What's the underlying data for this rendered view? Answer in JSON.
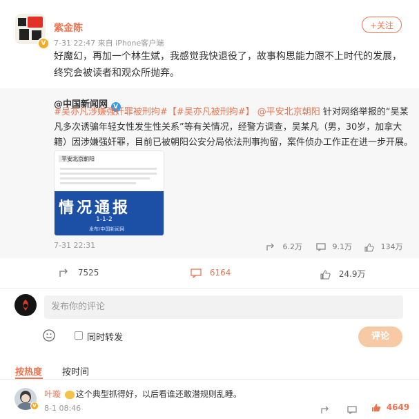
{
  "post": {
    "author": "紫金陈",
    "meta": "7-31 22:47  来自 iPhone客户端",
    "follow_label": "+关注",
    "text": "好魔幻，再加一个林生斌，我感觉我快退役了，故事构思能力跟不上时代的发展，终究会被读者和观众所抛弃。"
  },
  "repost": {
    "author": "@中国新闻网",
    "hashtag1": "#吴亦凡涉嫌强奸罪被刑拘#",
    "hashtag2": "【#吴亦凡被刑拘#】",
    "mention": "@平安北京朝阳",
    "text_rest": " 针对网络举报的“吴某凡多次诱骗年轻女性发生性关系”等有关情况，经警方调查，吴某凡（男，30岁，加拿大籍）因涉嫌强奸罪，目前已被朝阳公安分局依法刑事拘留，案件侦办工作正在进一步开展。",
    "thumb_header": "平安北京朝阳",
    "thumb_title": "情况通报",
    "thumb_date": "1-1-2",
    "thumb_sub": "发布/中国新闻网",
    "meta": "7-31 22:31",
    "shares": "6.2万",
    "comments": "9.1万",
    "likes": "134万"
  },
  "actions": {
    "shares": "7525",
    "comments": "6164",
    "likes": "24.9万"
  },
  "composer": {
    "placeholder": "发布你的评论",
    "also_repost": "同时转发",
    "submit": "评论"
  },
  "sort": {
    "hot": "按热度",
    "time": "按时间"
  },
  "comment": {
    "author": "叶璇",
    "text": "这个典型抓得好，以后看谁还敢潜规则乱睡。",
    "meta": "8-1 08:46",
    "likes": "4649"
  },
  "colors": {
    "accent": "#eb7350",
    "link": "#eb7350",
    "button_disabled": "#f7c9a5"
  }
}
